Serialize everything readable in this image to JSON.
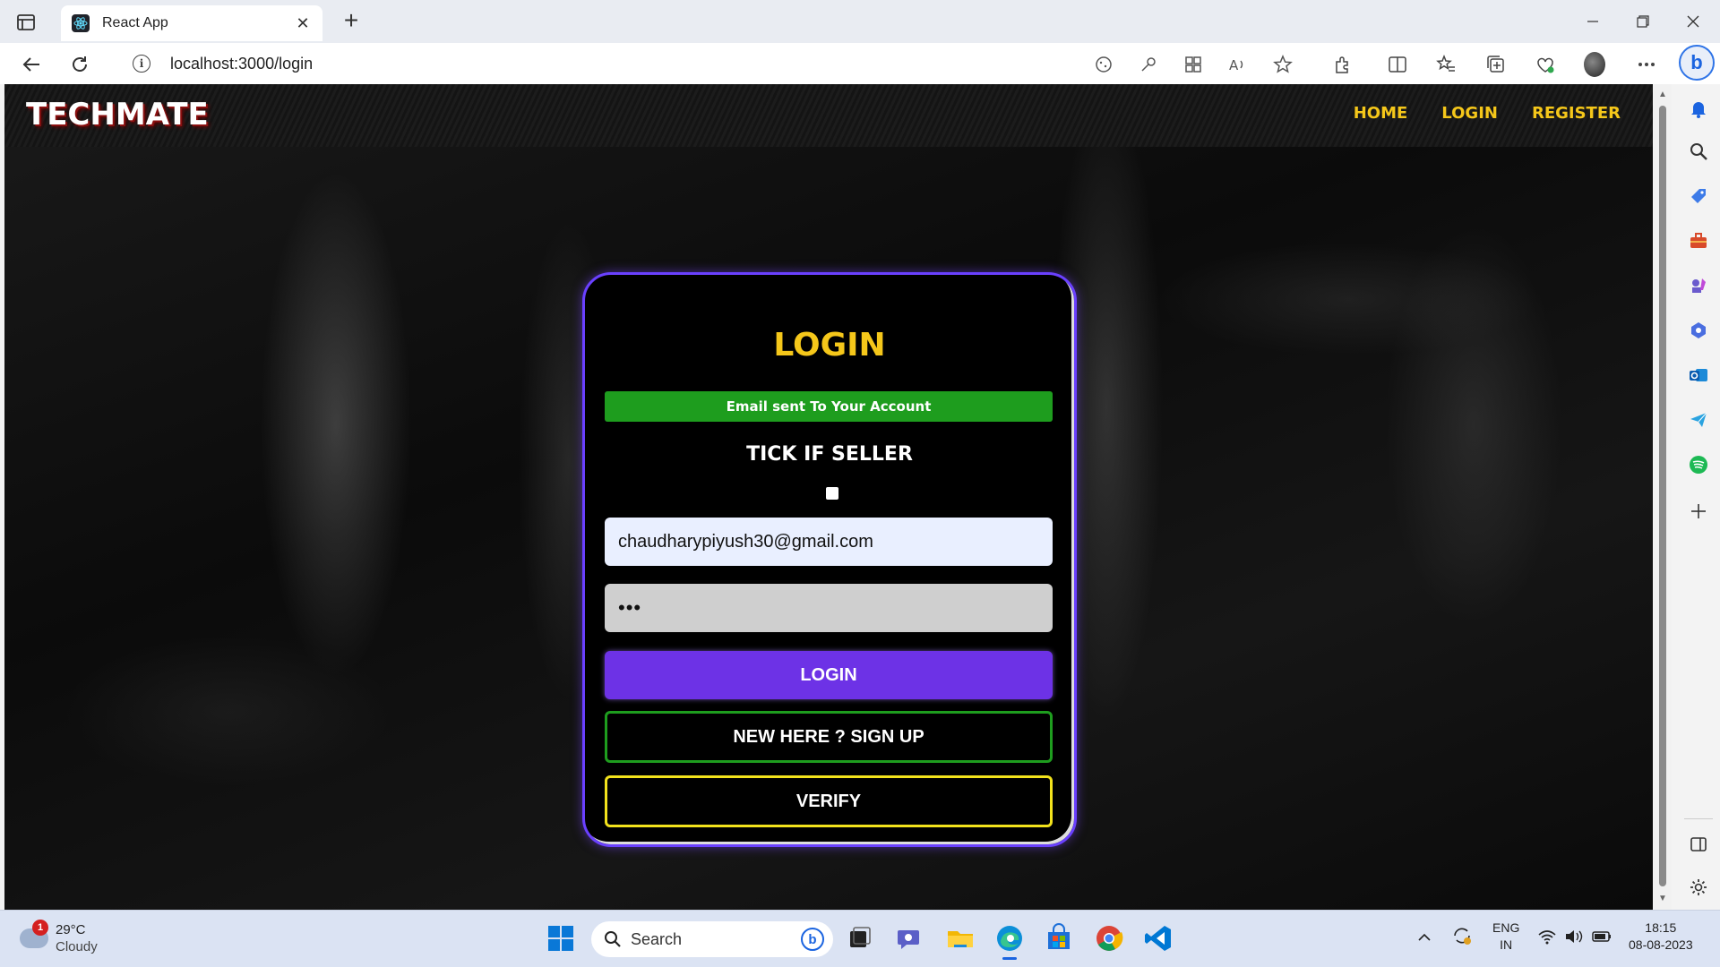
{
  "browser": {
    "tab_title": "React App",
    "url": "localhost:3000/login"
  },
  "site": {
    "brand": "TECHMATE",
    "nav": [
      "HOME",
      "LOGIN",
      "REGISTER"
    ]
  },
  "login_form": {
    "title": "LOGIN",
    "alert": "Email sent To Your Account",
    "seller_label": "TICK IF SELLER",
    "seller_checked": false,
    "email_value": "chaudharypiyush30@gmail.com",
    "password_mask": "•••",
    "login_button": "LOGIN",
    "signup_button": "NEW HERE ? SIGN UP",
    "verify_button": "VERIFY"
  },
  "colors": {
    "accent_yellow": "#f5c71a",
    "alert_green": "#1e9d1e",
    "login_purple": "#6d32e6",
    "card_border": "#6a40ff",
    "verify_border": "#f2e21c"
  },
  "taskbar": {
    "weather_badge": "1",
    "temperature": "29°C",
    "condition": "Cloudy",
    "search_placeholder": "Search",
    "language": "ENG",
    "region": "IN",
    "time": "18:15",
    "date": "08-08-2023"
  }
}
